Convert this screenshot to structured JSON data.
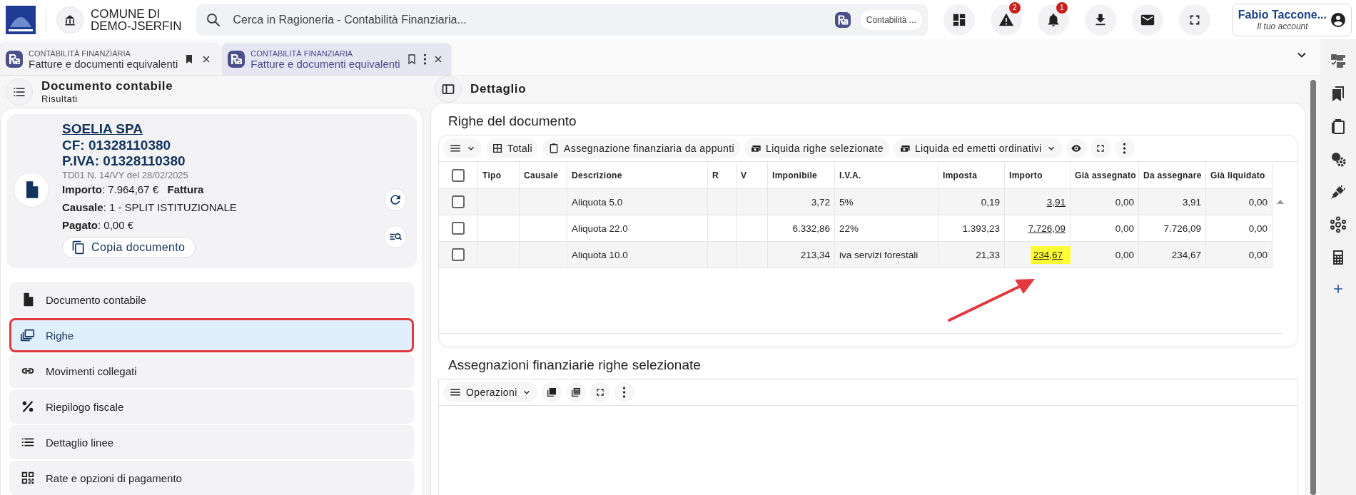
{
  "header": {
    "org": [
      "COMUNE DI",
      "DEMO-JSERFIN"
    ],
    "search": {
      "placeholder": "Cerca in Ragioneria - Contabilità Finanziaria...",
      "chip": "Contabilità ..."
    },
    "actions": [
      {
        "kind": "dashboard"
      },
      {
        "kind": "warning",
        "badge": "2"
      },
      {
        "kind": "bell",
        "badge": "1"
      },
      {
        "kind": "download"
      },
      {
        "kind": "mail"
      },
      {
        "kind": "fullscreen"
      }
    ],
    "account": {
      "name": "Fabio Taccone...",
      "subtitle": "Il tuo account"
    }
  },
  "tabs": [
    {
      "module": "CONTABILITÀ FINANZIARIA",
      "title": "Fatture e documenti equivalenti",
      "selected": false,
      "bookmarked": true
    },
    {
      "module": "CONTABILITÀ FINANZIARIA",
      "title": "Fatture e documenti equivalenti",
      "selected": true,
      "bookmarked": false
    }
  ],
  "left": {
    "title": "Documento contabile",
    "subtitle": "Risultati",
    "card": {
      "company": "SOELIA SPA",
      "lines": [
        "CF: 01328110380",
        "P.IVA: 01328110380"
      ],
      "doc": "TD01 N. 14/VY del 28/02/2025",
      "facts": [
        "**Importo**: 7.964,67 €   **Fattura**",
        "**Causale**: 1 - SPLIT ISTITUZIONALE",
        "**Pagato**: 0,00 €"
      ],
      "copy_button": "Copia documento"
    },
    "nav": [
      {
        "kind": "document",
        "label": "Documento contabile",
        "selected": false,
        "outlined": false
      },
      {
        "kind": "rows",
        "label": "Righe",
        "selected": true,
        "outlined": true
      },
      {
        "kind": "link",
        "label": "Movimenti collegati",
        "selected": false,
        "outlined": false
      },
      {
        "kind": "percent",
        "label": "Riepilogo fiscale",
        "selected": false,
        "outlined": false
      },
      {
        "kind": "list",
        "label": "Dettaglio linee",
        "selected": false,
        "outlined": false
      },
      {
        "kind": "qr",
        "label": "Rate e opzioni di pagamento",
        "selected": false,
        "outlined": false
      }
    ]
  },
  "detail": {
    "title": "Dettaglio",
    "rows_section": {
      "title": "Righe del documento",
      "toolbar": [
        {
          "kind": "table",
          "label": "Totali",
          "dropdown": false
        },
        {
          "kind": "clipboard",
          "label": "Assegnazione finanziaria da appunti",
          "dropdown": false
        },
        {
          "kind": "money",
          "label": "Liquida righe selezionate",
          "dropdown": false
        },
        {
          "kind": "money",
          "label": "Liquida ed emetti ordinativi",
          "dropdown": true
        }
      ],
      "columns": [
        {
          "label": "Tipo",
          "kind": "text"
        },
        {
          "label": "Causale",
          "kind": "text"
        },
        {
          "label": "Descrizione",
          "kind": "text"
        },
        {
          "label": "R",
          "kind": "text"
        },
        {
          "label": "V",
          "kind": "text"
        },
        {
          "label": "Imponibile",
          "kind": "number"
        },
        {
          "label": "I.V.A.",
          "kind": "text"
        },
        {
          "label": "Imposta",
          "kind": "number"
        },
        {
          "label": "Importo",
          "kind": "link"
        },
        {
          "label": "Già assegnato",
          "kind": "number"
        },
        {
          "label": "Da assegnare",
          "kind": "number"
        },
        {
          "label": "Già liquidato",
          "kind": "number"
        }
      ],
      "all_checked": false,
      "rows": [
        {
          "checked": false,
          "cells": [
            "",
            "",
            "Aliquota 5.0",
            "",
            "",
            "3,72",
            "5%",
            "0,19",
            "3,91",
            "0,00",
            "3,91",
            "0,00"
          ],
          "amount_highlighted": false
        },
        {
          "checked": false,
          "cells": [
            "",
            "",
            "Aliquota 22.0",
            "",
            "",
            "6.332,86",
            "22%",
            "1.393,23",
            "7.726,09",
            "0,00",
            "7.726,09",
            "0,00"
          ],
          "amount_highlighted": false
        },
        {
          "checked": false,
          "cells": [
            "",
            "",
            "Aliquota 10.0",
            "",
            "",
            "213,34",
            "iva servizi forestali",
            "21,33",
            "234,67",
            "0,00",
            "234,67",
            "0,00"
          ],
          "amount_highlighted": true
        }
      ],
      "annotation_arrow": true
    },
    "assign_section": {
      "title": "Assegnazioni finanziarie righe selezionate",
      "menu": "Operazioni"
    }
  }
}
